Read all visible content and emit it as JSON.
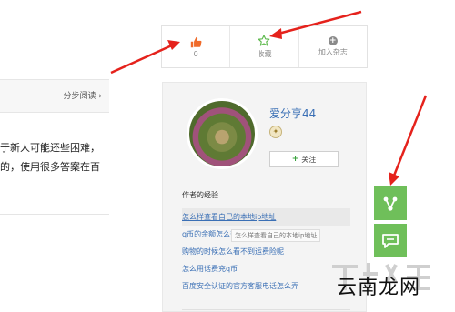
{
  "article": {
    "step_read": "分步阅读 ›",
    "lines": [
      "于新人可能还些困难，",
      "的，使用很多答案在百"
    ]
  },
  "actions": {
    "like_count": "0",
    "favorite_label": "收藏",
    "magazine_label": "加入杂志"
  },
  "author": {
    "name": "爱分享44",
    "badge_icon": "medal-icon",
    "follow_label": "关注",
    "experience_title": "作者的经验",
    "experiences": [
      "怎么样查看自己的本地ip地址",
      "q币的余额怎么查询",
      "购物的时候怎么看不到运费险呢",
      "怎么用话费充q币",
      "百度安全认证的官方客服电话怎么弄"
    ],
    "tooltip": "怎么样查看自己的本地ip地址"
  },
  "floating": {
    "share_icon": "share-icon",
    "comment_icon": "comment-icon"
  },
  "watermark": {
    "text": "云南龙网"
  },
  "colors": {
    "accent_green": "#6fbf5a",
    "link_blue": "#3a6fb5",
    "arrow_red": "#e5221c",
    "like_orange": "#f06b2a"
  }
}
